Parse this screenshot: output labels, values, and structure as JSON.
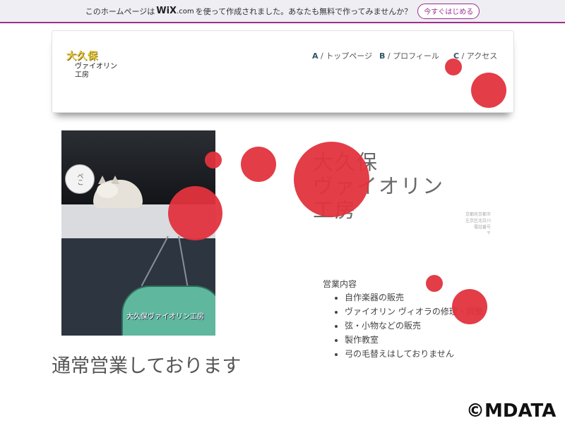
{
  "wix_banner": {
    "text_before": "このホームページは",
    "logo": "WiX",
    "logo_suffix": ".com",
    "text_after": "を使って作成されました。あなたも無料で作ってみませんか？",
    "button_label": "今すぐはじめる"
  },
  "header": {
    "logo_line1": "大久保",
    "logo_line2": "ヴァイオリン",
    "logo_line3": "工房",
    "nav": [
      {
        "key": "A",
        "label": "トップページ"
      },
      {
        "key": "B",
        "label": "プロフィール"
      },
      {
        "key": "C",
        "label": "アクセス"
      }
    ]
  },
  "photo": {
    "bubble_text": "ぺこ",
    "sign_text": "大久保ヴァイオリン工房"
  },
  "hero": {
    "title_line1": "大久保",
    "title_line2": "ヴァイオリン",
    "title_line3": "工房",
    "address_lines": [
      "京都府京都市",
      "左京区北白川",
      "電話番号",
      "〒"
    ]
  },
  "services": {
    "heading": "営業内容",
    "items": [
      "自作楽器の販売",
      "ヴァイオリン ヴィオラの修理・調整",
      "弦・小物などの販売",
      "製作教室",
      "弓の毛替えはしておりません"
    ]
  },
  "notice": "通常営業しております",
  "copyright": "©MDATA",
  "colors": {
    "accent": "#9c2f8f",
    "dot_red": "#e2333e",
    "nav_key": "#2f5566"
  }
}
